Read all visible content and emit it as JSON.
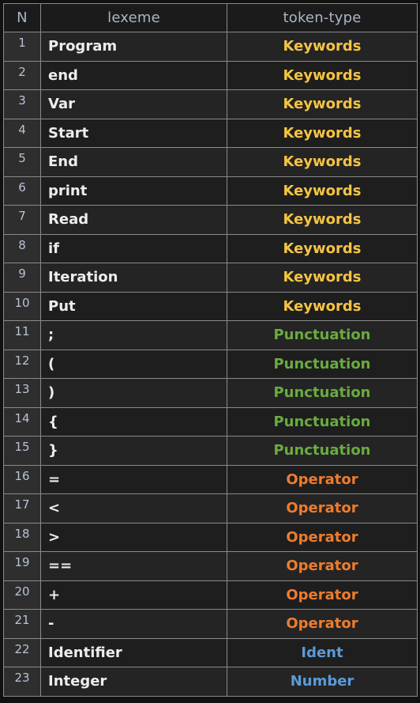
{
  "headers": [
    "N",
    "lexeme",
    "token-type"
  ],
  "colors": {
    "Keywords": "#f5c443",
    "Punctuation": "#6aab3f",
    "Operator": "#ee7c2e",
    "Ident": "#5c9ad8",
    "Number": "#5c9ad8"
  },
  "rows": [
    {
      "n": "1",
      "lexeme": "Program",
      "type": "Keywords"
    },
    {
      "n": "2",
      "lexeme": "end",
      "type": "Keywords"
    },
    {
      "n": "3",
      "lexeme": "Var",
      "type": "Keywords"
    },
    {
      "n": "4",
      "lexeme": "Start",
      "type": "Keywords"
    },
    {
      "n": "5",
      "lexeme": "End",
      "type": "Keywords"
    },
    {
      "n": "6",
      "lexeme": "print",
      "type": "Keywords"
    },
    {
      "n": "7",
      "lexeme": "Read",
      "type": "Keywords"
    },
    {
      "n": "8",
      "lexeme": "if",
      "type": "Keywords"
    },
    {
      "n": "9",
      "lexeme": "Iteration",
      "type": "Keywords"
    },
    {
      "n": "10",
      "lexeme": "Put",
      "type": "Keywords"
    },
    {
      "n": "11",
      "lexeme": ";",
      "type": "Punctuation"
    },
    {
      "n": "12",
      "lexeme": "(",
      "type": "Punctuation"
    },
    {
      "n": "13",
      "lexeme": ")",
      "type": "Punctuation"
    },
    {
      "n": "14",
      "lexeme": "{",
      "type": "Punctuation"
    },
    {
      "n": "15",
      "lexeme": "}",
      "type": "Punctuation"
    },
    {
      "n": "16",
      "lexeme": "=",
      "type": "Operator"
    },
    {
      "n": "17",
      "lexeme": "<",
      "type": "Operator"
    },
    {
      "n": "18",
      "lexeme": ">",
      "type": "Operator"
    },
    {
      "n": "19",
      "lexeme": "==",
      "type": "Operator"
    },
    {
      "n": "20",
      "lexeme": "+",
      "type": "Operator"
    },
    {
      "n": "21",
      "lexeme": "-",
      "type": "Operator"
    },
    {
      "n": "22",
      "lexeme": "Identifier",
      "type": "Ident"
    },
    {
      "n": "23",
      "lexeme": "Integer",
      "type": "Number"
    }
  ]
}
